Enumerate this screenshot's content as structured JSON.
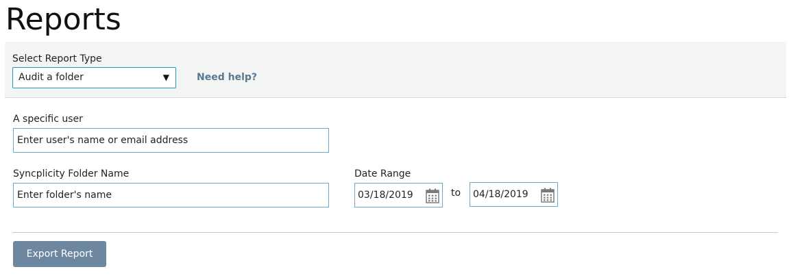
{
  "page": {
    "title": "Reports"
  },
  "report_type": {
    "label": "Select Report Type",
    "selected": "Audit a folder",
    "arrow_glyph": "▼",
    "help_link": "Need help?"
  },
  "user_filter": {
    "label": "A specific user",
    "value": "Enter user's name or email address"
  },
  "folder_filter": {
    "label": "Syncplicity Folder Name",
    "value": "Enter folder's name"
  },
  "date_range": {
    "label": "Date Range",
    "start": "03/18/2019",
    "separator": "to",
    "end": "04/18/2019",
    "icon": "calendar-icon"
  },
  "actions": {
    "export_label": "Export Report"
  },
  "colors": {
    "input_border": "#6aa9c7",
    "select_border": "#2d8fbf",
    "link": "#5b7891",
    "button_bg": "#6e87a0",
    "panel_bg": "#f3f4f4"
  }
}
